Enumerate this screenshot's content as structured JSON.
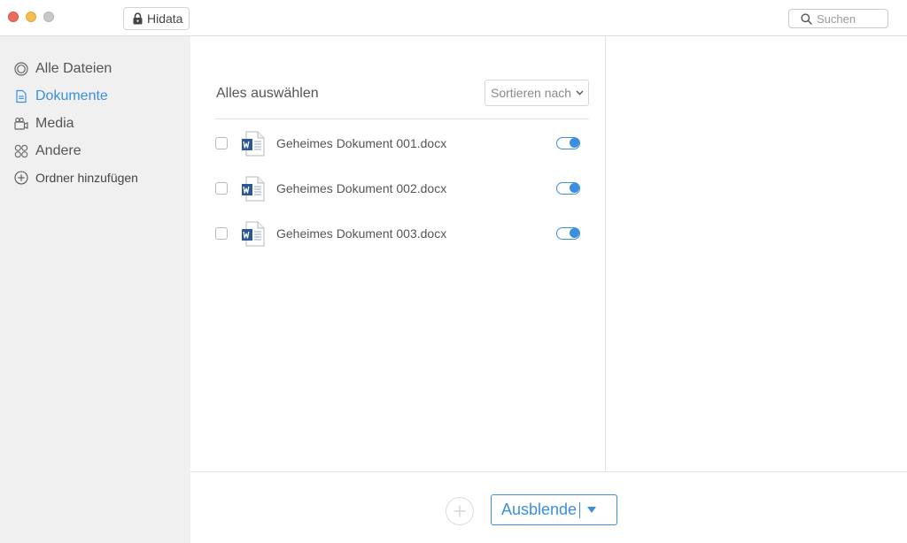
{
  "titlebar": {
    "app_name": "Hidata",
    "search_placeholder": "Suchen"
  },
  "sidebar": {
    "items": [
      {
        "label": "Alle Dateien",
        "icon": "all-files-icon",
        "active": false
      },
      {
        "label": "Dokumente",
        "icon": "document-icon",
        "active": true
      },
      {
        "label": "Media",
        "icon": "media-icon",
        "active": false
      },
      {
        "label": "Andere",
        "icon": "other-icon",
        "active": false
      }
    ],
    "add_folder_label": "Ordner hinzufügen"
  },
  "main": {
    "select_all_label": "Alles auswählen",
    "sort_label": "Sortieren nach",
    "files": [
      {
        "name": "Geheimes Dokument 001.docx",
        "checked": false,
        "hidden_toggle": true
      },
      {
        "name": "Geheimes Dokument 002.docx",
        "checked": false,
        "hidden_toggle": true
      },
      {
        "name": "Geheimes Dokument 003.docx",
        "checked": false,
        "hidden_toggle": true
      }
    ]
  },
  "bottombar": {
    "hide_button_label": "Ausblende"
  },
  "colors": {
    "accent": "#3b8fe0",
    "sidebar_bg": "#f0f0f1",
    "word_blue": "#2b579a",
    "close": "#ed6a5e",
    "minimize": "#f5bf4f",
    "maximize": "#c8c8c8"
  }
}
